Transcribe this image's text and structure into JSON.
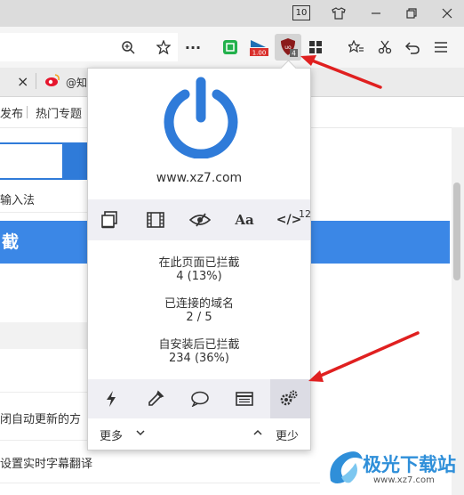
{
  "titlebar": {
    "tab_count": "10",
    "icons": [
      "shirt-icon",
      "minimize-icon",
      "restore-icon",
      "close-icon"
    ]
  },
  "toolbar": {
    "icons": [
      "zoom-icon",
      "star-icon",
      "more-icon",
      "green-book-icon",
      "speed-badge-icon",
      "ublock-icon",
      "apps-grid-icon",
      "favorites-icon",
      "scissors-icon",
      "undo-icon",
      "menu-icon"
    ],
    "speed_badge": "1.00",
    "ublock_badge": "4"
  },
  "tabs": {
    "close": "×",
    "tab_label": "@知"
  },
  "bookmarks": {
    "items": [
      "发布",
      "热门专题"
    ]
  },
  "page": {
    "line1": "输入法",
    "blue_bar_text": "截",
    "line2": "闭自动更新的方",
    "line3": "设置实时字幕翻译"
  },
  "popup": {
    "domain": "www.xz7.com",
    "tool_icons": [
      "element-zapper-icon",
      "media-filmstrip-icon",
      "eye-slash-icon",
      "font-icon",
      "code-icon"
    ],
    "font_label": "Aa",
    "code_label": "</>",
    "code_count": "12",
    "stats": [
      {
        "label": "在此页面已拦截",
        "value": "4 (13%)"
      },
      {
        "label": "已连接的域名",
        "value": "2 / 5"
      },
      {
        "label": "自安装后已拦截",
        "value": "234 (36%)"
      }
    ],
    "bottom_icons": [
      "lightning-icon",
      "eyedropper-icon",
      "speech-bubble-icon",
      "list-icon",
      "settings-gears-icon"
    ],
    "more_label": "更多",
    "less_label": "更少"
  },
  "watermark": {
    "brand": "极光下载站",
    "url": "www.xz7.com"
  },
  "colors": {
    "power_blue": "#2f7bd9",
    "arrow_red": "#e02020",
    "page_blue": "#3b87e6"
  }
}
